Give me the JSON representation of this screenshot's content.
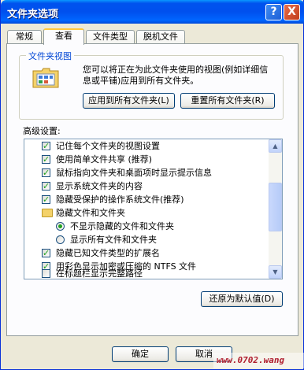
{
  "window": {
    "title": "文件夹选项",
    "help_label": "?",
    "close_label": "X"
  },
  "tabs": [
    {
      "label": "常规",
      "active": false
    },
    {
      "label": "查看",
      "active": true
    },
    {
      "label": "文件类型",
      "active": false
    },
    {
      "label": "脱机文件",
      "active": false
    }
  ],
  "folder_views": {
    "title": "文件夹视图",
    "description": "您可以将正在为此文件夹使用的视图(例如详细信息或平铺)应用到所有文件夹。",
    "apply_all_label": "应用到所有文件夹(L)",
    "reset_all_label": "重置所有文件夹(R)"
  },
  "advanced": {
    "label": "高级设置:",
    "items": [
      {
        "type": "checkbox",
        "checked": true,
        "text": "记住每个文件夹的视图设置"
      },
      {
        "type": "checkbox",
        "checked": true,
        "text": "使用简单文件共享 (推荐)"
      },
      {
        "type": "checkbox",
        "checked": true,
        "text": "鼠标指向文件夹和桌面项时显示提示信息"
      },
      {
        "type": "checkbox",
        "checked": true,
        "text": "显示系统文件夹的内容"
      },
      {
        "type": "checkbox",
        "checked": true,
        "text": "隐藏受保护的操作系统文件(推荐)"
      },
      {
        "type": "folder",
        "checked": false,
        "text": "隐藏文件和文件夹"
      },
      {
        "type": "radio",
        "checked": true,
        "text": "不显示隐藏的文件和文件夹"
      },
      {
        "type": "radio",
        "checked": false,
        "text": "显示所有文件和文件夹"
      },
      {
        "type": "checkbox",
        "checked": true,
        "text": "隐藏已知文件类型的扩展名"
      },
      {
        "type": "checkbox",
        "checked": true,
        "text": "用彩色显示加密或压缩的 NTFS 文件"
      },
      {
        "type": "checkbox",
        "checked": false,
        "text": "在标题栏显示完整路径"
      }
    ],
    "restore_defaults_label": "还原为默认值(D)"
  },
  "footer": {
    "ok_label": "确定",
    "cancel_label": "取消"
  },
  "watermark": "www.0702.wang",
  "colors": {
    "titlebar": "#0054e3",
    "face": "#ece9d8",
    "check_green": "#21a121",
    "group_title": "#0046d5"
  }
}
